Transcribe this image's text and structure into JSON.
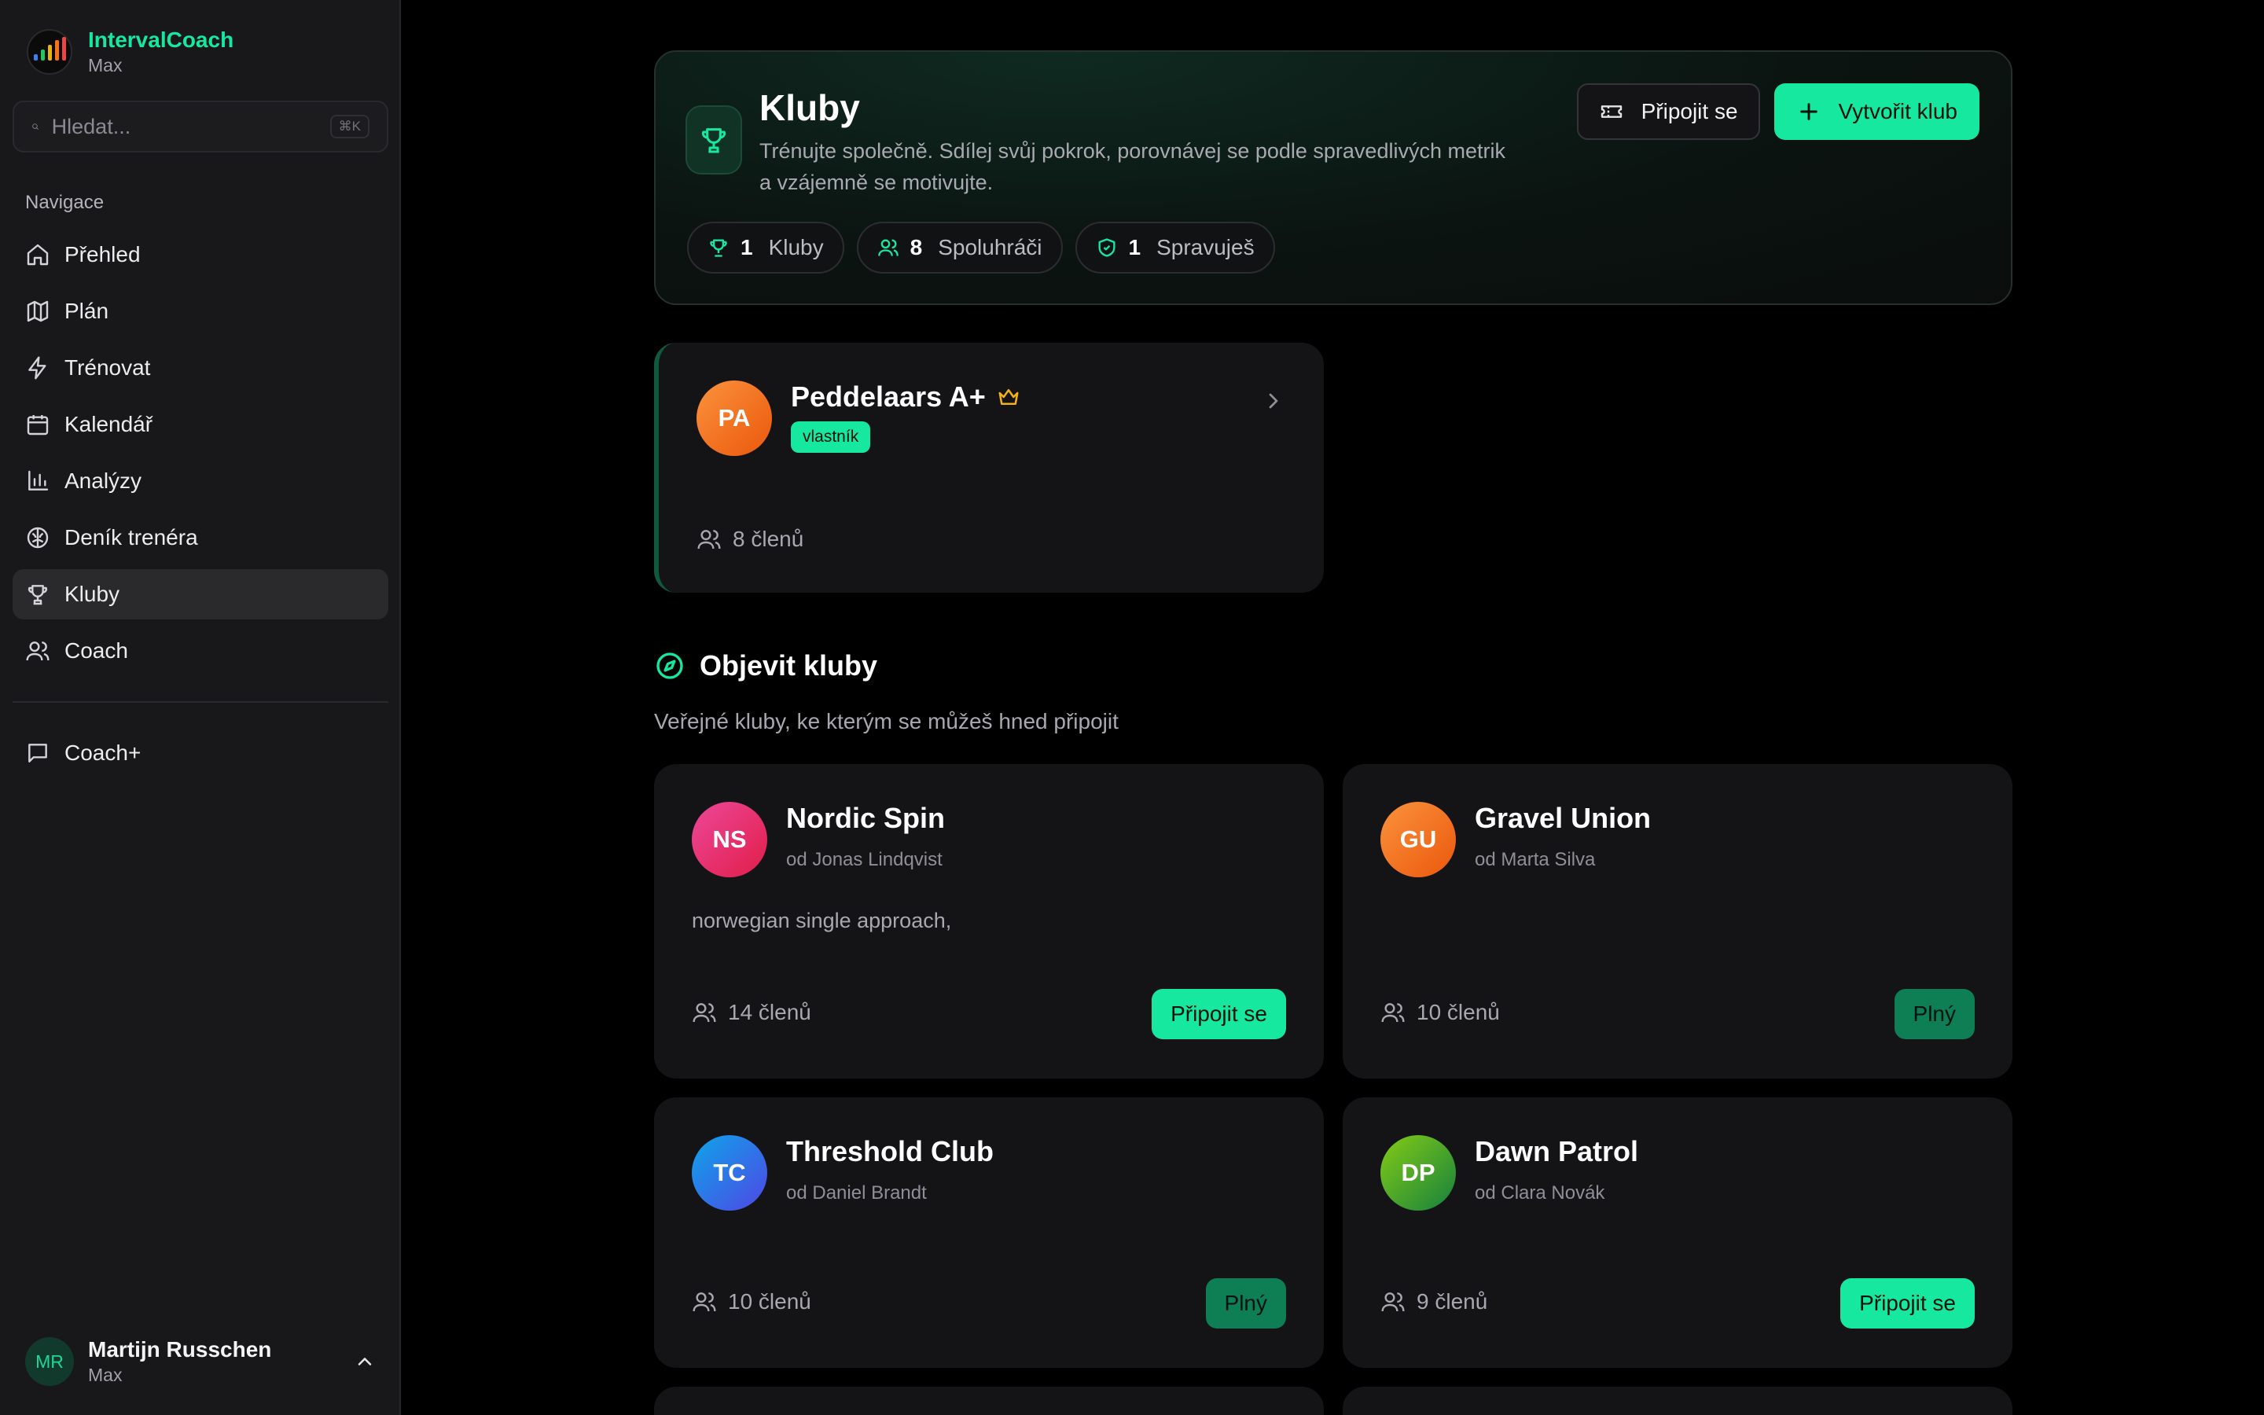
{
  "app": {
    "name": "IntervalCoach",
    "subtitle": "Max"
  },
  "search": {
    "placeholder": "Hledat...",
    "shortcut": "⌘K"
  },
  "nav": {
    "title": "Navigace",
    "items": [
      {
        "label": "Přehled",
        "icon": "home-icon"
      },
      {
        "label": "Plán",
        "icon": "map-icon"
      },
      {
        "label": "Trénovat",
        "icon": "bolt-icon"
      },
      {
        "label": "Kalendář",
        "icon": "calendar-icon"
      },
      {
        "label": "Analýzy",
        "icon": "bar-chart-icon"
      },
      {
        "label": "Deník trenéra",
        "icon": "brain-icon"
      },
      {
        "label": "Kluby",
        "icon": "trophy-icon",
        "active": true
      },
      {
        "label": "Coach",
        "icon": "users-icon"
      }
    ],
    "secondary": [
      {
        "label": "Coach+",
        "icon": "chat-icon"
      }
    ]
  },
  "user": {
    "initials": "MR",
    "name": "Martijn Russchen",
    "subtitle": "Max"
  },
  "hero": {
    "title": "Kluby",
    "description": "Trénujte společně. Sdílej svůj pokrok, porovnávej se podle spravedlivých metrik a vzájemně se motivujte.",
    "join_label": "Připojit se",
    "create_label": "Vytvořit klub",
    "stats": [
      {
        "value": "1",
        "label": "Kluby",
        "icon": "trophy-icon"
      },
      {
        "value": "8",
        "label": "Spoluhráči",
        "icon": "users-icon"
      },
      {
        "value": "1",
        "label": "Spravuješ",
        "icon": "shield-icon"
      }
    ]
  },
  "my_club": {
    "initials": "PA",
    "name": "Peddelaars A+",
    "badge": "vlastník",
    "members": "8 členů"
  },
  "discover": {
    "title": "Objevit kluby",
    "subtitle": "Veřejné kluby, ke kterým se můžeš hned připojit",
    "clubs": [
      {
        "initials": "NS",
        "name": "Nordic Spin",
        "owner": "od Jonas Lindqvist",
        "description": "norwegian single approach,",
        "members": "14 členů",
        "action": "Připojit se"
      },
      {
        "initials": "GU",
        "name": "Gravel Union",
        "owner": "od Marta Silva",
        "description": "",
        "members": "10 členů",
        "action": "Plný"
      },
      {
        "initials": "TC",
        "name": "Threshold Club",
        "owner": "od Daniel Brandt",
        "description": "",
        "members": "10 členů",
        "action": "Plný"
      },
      {
        "initials": "DP",
        "name": "Dawn Patrol",
        "owner": "od Clara Novák",
        "description": "",
        "members": "9 členů",
        "action": "Připojit se"
      }
    ]
  },
  "colors": {
    "accent": "#17e8a0",
    "background": "#000000",
    "sidebar": "#18181b",
    "card": "#141416"
  }
}
